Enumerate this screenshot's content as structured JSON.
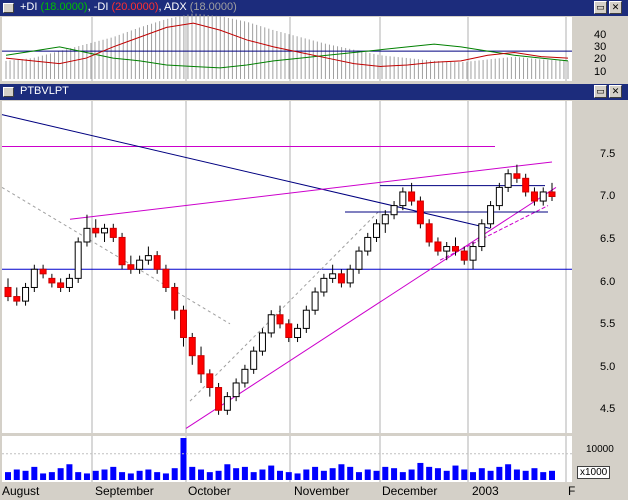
{
  "indicator_pane": {
    "title_plus_di_prefix": "+DI",
    "title_plus_di_value": "(18.0000)",
    "title_minus_di_prefix": ", -DI",
    "title_minus_di_value": "(20.0000)",
    "title_adx_prefix": ", ADX",
    "title_adx_value": "(18.0000)",
    "y_ticks": [
      "40",
      "30",
      "20",
      "10"
    ],
    "colors": {
      "plus_di": "#008000",
      "minus_di": "#c00000",
      "adx": "#a0a0a0",
      "level_line": "#000080"
    }
  },
  "price_pane": {
    "title": "PTBVLPT",
    "y_ticks": [
      "7.5",
      "7.0",
      "6.5",
      "6.0",
      "5.5",
      "5.0",
      "4.5"
    ],
    "colors": {
      "up_candle": "#ffffff",
      "down_candle": "#ff0000",
      "trendline_blue": "#000080",
      "trendline_magenta": "#cc00cc",
      "horizontal": "#0000cc"
    }
  },
  "volume_pane": {
    "y_tick": "10000",
    "multiplier_label": "x1000",
    "bar_color": "#0000ff"
  },
  "x_axis": {
    "labels": [
      "August",
      "September",
      "October",
      "November",
      "December",
      "2003",
      "F"
    ]
  },
  "buttons": {
    "restore_symbol": "▭",
    "close_symbol": "✕"
  },
  "chart_data": [
    {
      "type": "line",
      "title": "",
      "series": [
        {
          "name": "+DI",
          "color": "#008000",
          "values": [
            22,
            25,
            28,
            24,
            20,
            18,
            15,
            14,
            13,
            15,
            18,
            20,
            22,
            24,
            26,
            28,
            30,
            28,
            25,
            22,
            20,
            18
          ]
        },
        {
          "name": "-DI",
          "color": "#c00000",
          "values": [
            20,
            18,
            16,
            20,
            28,
            35,
            42,
            45,
            40,
            33,
            28,
            24,
            20,
            16,
            14,
            15,
            17,
            18,
            22,
            24,
            21,
            20
          ]
        },
        {
          "name": "ADX",
          "color": "#a0a0a0",
          "values": [
            18,
            20,
            25,
            30,
            35,
            42,
            48,
            52,
            50,
            46,
            40,
            35,
            30,
            26,
            22,
            20,
            18,
            17,
            19,
            21,
            19,
            18
          ]
        }
      ],
      "ylim": [
        5,
        48
      ],
      "y_ticks": [
        40,
        30,
        20,
        10
      ],
      "reference_level": 25
    },
    {
      "type": "candlestick",
      "title": "",
      "ylim": [
        4.35,
        8.0
      ],
      "y_ticks": [
        7.5,
        7.0,
        6.5,
        6.0,
        5.5,
        5.0,
        4.5
      ],
      "candles": [
        [
          5.95,
          6.05,
          5.8,
          5.85
        ],
        [
          5.85,
          5.95,
          5.75,
          5.8
        ],
        [
          5.8,
          6.0,
          5.75,
          5.95
        ],
        [
          5.95,
          6.2,
          5.9,
          6.15
        ],
        [
          6.15,
          6.2,
          6.05,
          6.1
        ],
        [
          6.05,
          6.1,
          5.95,
          6.0
        ],
        [
          6.0,
          6.05,
          5.9,
          5.95
        ],
        [
          5.95,
          6.1,
          5.9,
          6.05
        ],
        [
          6.05,
          6.5,
          6.0,
          6.45
        ],
        [
          6.45,
          6.75,
          6.4,
          6.6
        ],
        [
          6.6,
          6.7,
          6.5,
          6.55
        ],
        [
          6.55,
          6.65,
          6.45,
          6.6
        ],
        [
          6.6,
          6.65,
          6.45,
          6.5
        ],
        [
          6.5,
          6.55,
          6.15,
          6.2
        ],
        [
          6.2,
          6.3,
          6.1,
          6.15
        ],
        [
          6.15,
          6.3,
          6.1,
          6.25
        ],
        [
          6.25,
          6.4,
          6.2,
          6.3
        ],
        [
          6.3,
          6.35,
          6.1,
          6.15
        ],
        [
          6.15,
          6.2,
          5.9,
          5.95
        ],
        [
          5.95,
          6.0,
          5.6,
          5.7
        ],
        [
          5.7,
          5.75,
          5.3,
          5.4
        ],
        [
          5.4,
          5.45,
          5.1,
          5.2
        ],
        [
          5.2,
          5.3,
          4.9,
          5.0
        ],
        [
          5.0,
          5.05,
          4.75,
          4.85
        ],
        [
          4.85,
          4.9,
          4.55,
          4.6
        ],
        [
          4.6,
          4.8,
          4.55,
          4.75
        ],
        [
          4.75,
          4.95,
          4.7,
          4.9
        ],
        [
          4.9,
          5.1,
          4.85,
          5.05
        ],
        [
          5.05,
          5.3,
          5.0,
          5.25
        ],
        [
          5.25,
          5.5,
          5.2,
          5.45
        ],
        [
          5.45,
          5.7,
          5.4,
          5.65
        ],
        [
          5.65,
          5.75,
          5.5,
          5.55
        ],
        [
          5.55,
          5.6,
          5.35,
          5.4
        ],
        [
          5.4,
          5.55,
          5.35,
          5.5
        ],
        [
          5.5,
          5.75,
          5.45,
          5.7
        ],
        [
          5.7,
          5.95,
          5.65,
          5.9
        ],
        [
          5.9,
          6.1,
          5.85,
          6.05
        ],
        [
          6.05,
          6.2,
          6.0,
          6.1
        ],
        [
          6.1,
          6.15,
          5.95,
          6.0
        ],
        [
          6.0,
          6.2,
          5.95,
          6.15
        ],
        [
          6.15,
          6.4,
          6.1,
          6.35
        ],
        [
          6.35,
          6.55,
          6.3,
          6.5
        ],
        [
          6.5,
          6.7,
          6.45,
          6.65
        ],
        [
          6.65,
          6.8,
          6.55,
          6.75
        ],
        [
          6.75,
          6.9,
          6.7,
          6.85
        ],
        [
          6.85,
          7.05,
          6.8,
          7.0
        ],
        [
          7.0,
          7.1,
          6.85,
          6.9
        ],
        [
          6.9,
          6.95,
          6.6,
          6.65
        ],
        [
          6.65,
          6.7,
          6.4,
          6.45
        ],
        [
          6.45,
          6.5,
          6.3,
          6.35
        ],
        [
          6.35,
          6.45,
          6.25,
          6.4
        ],
        [
          6.4,
          6.5,
          6.3,
          6.35
        ],
        [
          6.35,
          6.4,
          6.2,
          6.25
        ],
        [
          6.25,
          6.45,
          6.15,
          6.4
        ],
        [
          6.4,
          6.7,
          6.35,
          6.65
        ],
        [
          6.65,
          6.9,
          6.6,
          6.85
        ],
        [
          6.85,
          7.1,
          6.8,
          7.05
        ],
        [
          7.05,
          7.25,
          7.0,
          7.2
        ],
        [
          7.2,
          7.3,
          7.1,
          7.15
        ],
        [
          7.15,
          7.2,
          6.95,
          7.0
        ],
        [
          7.0,
          7.05,
          6.85,
          6.9
        ],
        [
          6.9,
          7.05,
          6.85,
          7.0
        ],
        [
          7.0,
          7.1,
          6.9,
          6.95
        ]
      ]
    },
    {
      "type": "bar",
      "title": "",
      "ylim": [
        0,
        16000
      ],
      "y_ticks": [
        10000
      ],
      "values": [
        3000,
        4000,
        3500,
        5000,
        2500,
        3000,
        4500,
        6000,
        3000,
        2500,
        3500,
        4000,
        5000,
        3000,
        2500,
        3500,
        4000,
        3000,
        2500,
        4500,
        16000,
        5000,
        4000,
        3000,
        3500,
        6000,
        4500,
        5000,
        3000,
        4000,
        5500,
        3500,
        3000,
        2500,
        4000,
        5000,
        3500,
        4500,
        6000,
        5000,
        3000,
        4000,
        3500,
        5000,
        4500,
        3000,
        4000,
        6500,
        5000,
        4500,
        3500,
        5500,
        4000,
        3000,
        4500,
        3500,
        5000,
        6000,
        4000,
        3500,
        4500,
        3000,
        3500
      ]
    }
  ]
}
